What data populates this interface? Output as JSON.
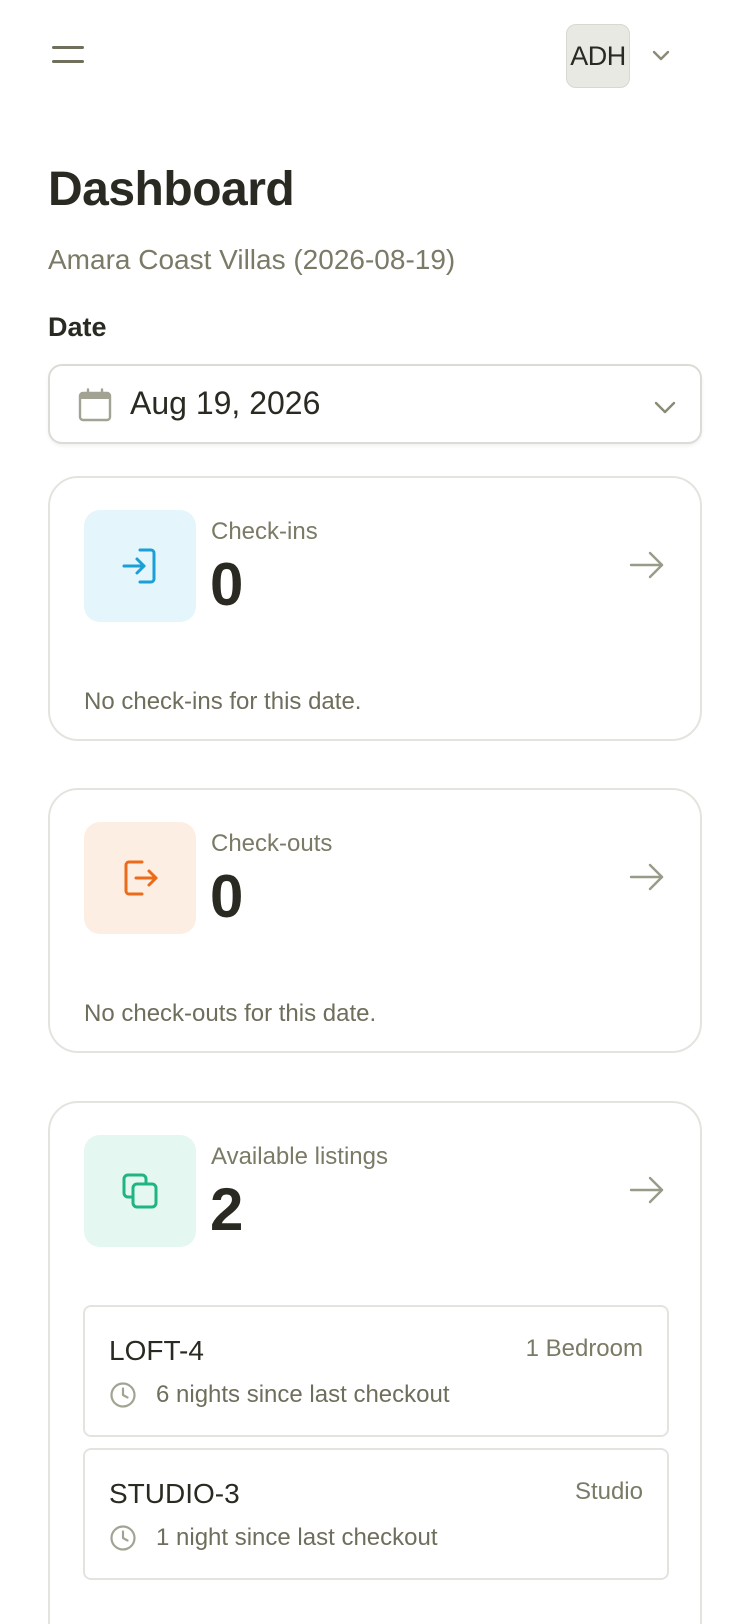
{
  "header": {
    "menu_icon": "hamburger-menu-icon",
    "avatar_initials": "ADH",
    "avatar_chevron_icon": "chevron-down-icon"
  },
  "page": {
    "title": "Dashboard",
    "subtitle": "Amara Coast Villas (2026-08-19)"
  },
  "date_filter": {
    "label": "Date",
    "value": "Aug 19, 2026",
    "icon": "calendar-icon"
  },
  "cards": {
    "checkins": {
      "label": "Check-ins",
      "count": "0",
      "empty_text": "No check-ins for this date.",
      "icon": "login-icon",
      "accent": "#1a9fd6",
      "icon_bg": "#e5f5fc"
    },
    "checkouts": {
      "label": "Check-outs",
      "count": "0",
      "empty_text": "No check-outs for this date.",
      "icon": "logout-icon",
      "accent": "#ec6b1a",
      "icon_bg": "#fdeee4"
    },
    "available": {
      "label": "Available listings",
      "count": "2",
      "icon": "copy-icon",
      "accent": "#1fb583",
      "icon_bg": "#e4f7f0",
      "listings": [
        {
          "name": "LOFT-4",
          "type": "1 Bedroom",
          "since": "6 nights since last checkout"
        },
        {
          "name": "STUDIO-3",
          "type": "Studio",
          "since": "1 night since last checkout"
        }
      ]
    }
  }
}
